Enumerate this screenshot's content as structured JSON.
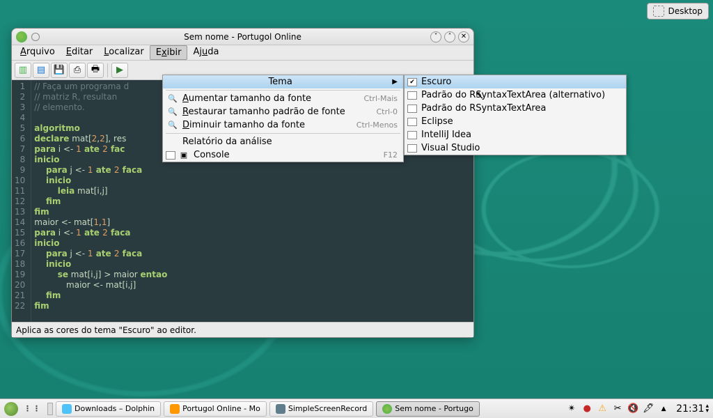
{
  "desktop": {
    "pager_label": "Desktop"
  },
  "window": {
    "title": "Sem nome - Portugol Online",
    "menus": {
      "arquivo": "Arquivo",
      "editar": "Editar",
      "localizar": "Localizar",
      "exibir": "Exibir",
      "ajuda": "Ajuda"
    },
    "statusbar": "Aplica as cores do tema \"Escuro\" ao editor."
  },
  "exibir_menu": {
    "tema": "Tema",
    "zoom_in": "Aumentar tamanho da fonte",
    "zoom_in_accel": "Ctrl-Mais",
    "zoom_reset": "Restaurar tamanho padrão de fonte",
    "zoom_reset_accel": "Ctrl-0",
    "zoom_out": "Diminuir tamanho da fonte",
    "zoom_out_accel": "Ctrl-Menos",
    "report": "Relatório da análise",
    "console": "Console",
    "console_accel": "F12"
  },
  "tema_menu": {
    "escuro": "Escuro",
    "rsyntax_alt": "Padrão do RSyntaxTextArea (alternativo)",
    "rsyntax": "Padrão do RSyntaxTextArea",
    "eclipse": "Eclipse",
    "intellij": "IntelliJ Idea",
    "vs": "Visual Studio"
  },
  "code": {
    "lines": 22,
    "l1": "// Faça um programa d",
    "l2": "// matriz R, resultan",
    "l3": "// elemento.",
    "l5": "algoritmo",
    "l6_a": "declare",
    "l6_b": " mat[",
    "l6_c": "2",
    "l6_d": ",",
    "l6_e": "2",
    "l6_f": "], res",
    "l7_a": "para",
    "l7_b": " i <- ",
    "l7_c": "1",
    "l7_d": " ate ",
    "l7_e": "2",
    "l7_f": " fac",
    "l8": "inicio",
    "l9_a": "    para",
    "l9_b": " j <- ",
    "l9_c": "1",
    "l9_d": " ate ",
    "l9_e": "2",
    "l9_f": " faca",
    "l10": "    inicio",
    "l11_a": "        leia",
    "l11_b": " mat[i,j]",
    "l12": "    fim",
    "l13": "fim",
    "l14_a": "maior <- mat[",
    "l14_b": "1",
    "l14_c": ",",
    "l14_d": "1",
    "l14_e": "]",
    "l15_a": "para",
    "l15_b": " i <- ",
    "l15_c": "1",
    "l15_d": " ate ",
    "l15_e": "2",
    "l15_f": " faca",
    "l16": "inicio",
    "l17_a": "    para",
    "l17_b": " j <- ",
    "l17_c": "1",
    "l17_d": " ate ",
    "l17_e": "2",
    "l17_f": " faca",
    "l18": "    inicio",
    "l19_a": "        se",
    "l19_b": " mat[i,j] > maior ",
    "l19_c": "entao",
    "l20": "            maior <- mat[i,j]",
    "l21": "    fim",
    "l22": "fim"
  },
  "taskbar": {
    "t1": "Downloads – Dolphin",
    "t2": "Portugol Online - Mo",
    "t3": "SimpleScreenRecord",
    "t4": "Sem nome - Portugo",
    "clock": "21:31"
  }
}
